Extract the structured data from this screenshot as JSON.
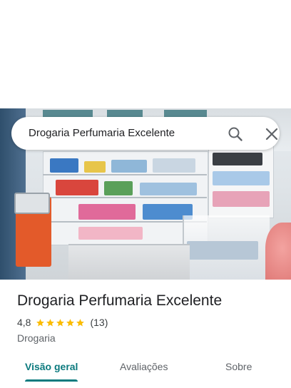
{
  "search": {
    "query": "Drogaria Perfumaria Excelente",
    "search_icon": "search-icon",
    "close_icon": "close-icon"
  },
  "place": {
    "name": "Drogaria Perfumaria Excelente",
    "rating": "4,8",
    "stars": 5,
    "review_count": "(13)",
    "category": "Drogaria"
  },
  "tabs": [
    {
      "label": "Visão geral",
      "active": true
    },
    {
      "label": "Avaliações",
      "active": false
    },
    {
      "label": "Sobre",
      "active": false
    }
  ],
  "colors": {
    "accent": "#0b7a7e",
    "star": "#fbbc04",
    "text_primary": "#202124",
    "text_secondary": "#5f6368"
  }
}
